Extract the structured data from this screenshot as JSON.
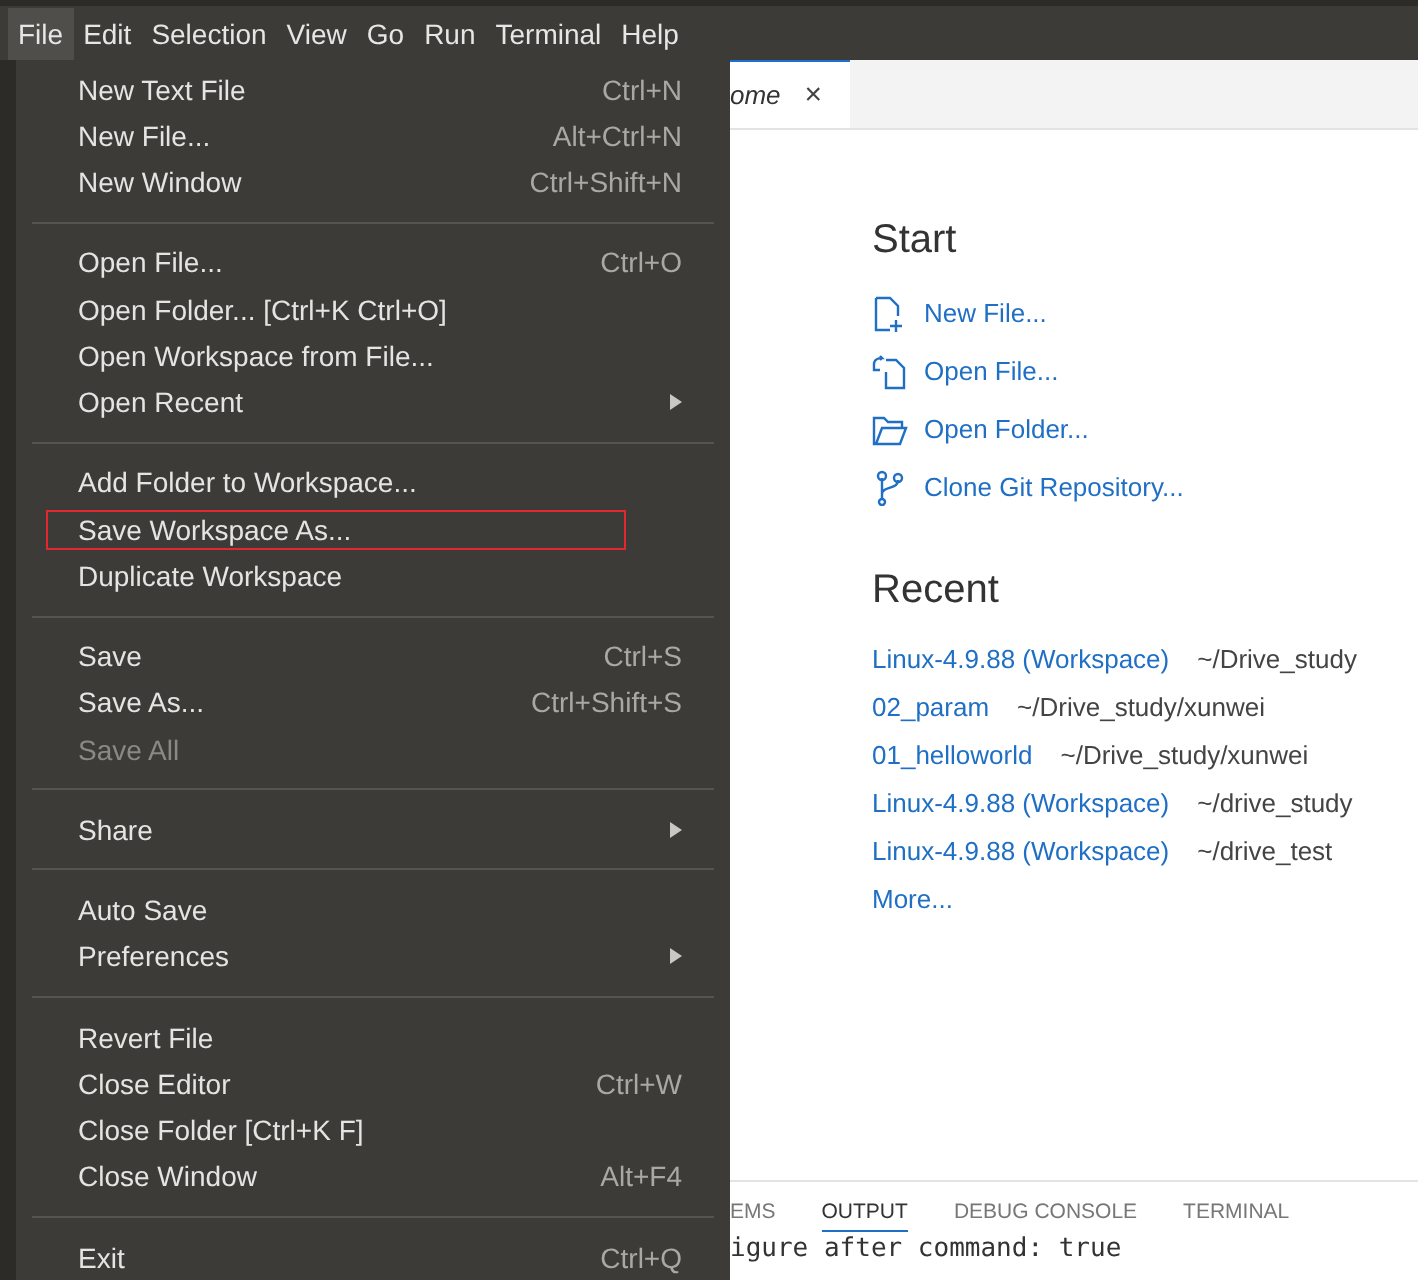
{
  "menubar": [
    {
      "label": "File",
      "selected": true
    },
    {
      "label": "Edit",
      "selected": false
    },
    {
      "label": "Selection",
      "selected": false
    },
    {
      "label": "View",
      "selected": false
    },
    {
      "label": "Go",
      "selected": false
    },
    {
      "label": "Run",
      "selected": false
    },
    {
      "label": "Terminal",
      "selected": false
    },
    {
      "label": "Help",
      "selected": false
    }
  ],
  "file_menu": [
    [
      {
        "label": "New Text File",
        "shortcut": "Ctrl+N",
        "disabled": false,
        "submenu": false,
        "annotated": false
      },
      {
        "label": "New File...",
        "shortcut": "Alt+Ctrl+N",
        "disabled": false,
        "submenu": false,
        "annotated": false
      },
      {
        "label": "New Window",
        "shortcut": "Ctrl+Shift+N",
        "disabled": false,
        "submenu": false,
        "annotated": false
      }
    ],
    [
      {
        "label": "Open File...",
        "shortcut": "Ctrl+O",
        "disabled": false,
        "submenu": false,
        "annotated": false
      },
      {
        "label": "Open Folder... [Ctrl+K Ctrl+O]",
        "disabled": false,
        "submenu": false,
        "annotated": false
      },
      {
        "label": "Open Workspace from File...",
        "disabled": false,
        "submenu": false,
        "annotated": false
      },
      {
        "label": "Open Recent",
        "disabled": false,
        "submenu": true,
        "annotated": false
      }
    ],
    [
      {
        "label": "Add Folder to Workspace...",
        "disabled": false,
        "submenu": false,
        "annotated": false
      },
      {
        "label": "Save Workspace As...",
        "disabled": false,
        "submenu": false,
        "annotated": true
      },
      {
        "label": "Duplicate Workspace",
        "disabled": false,
        "submenu": false,
        "annotated": false
      }
    ],
    [
      {
        "label": "Save",
        "shortcut": "Ctrl+S",
        "disabled": false,
        "submenu": false,
        "annotated": false
      },
      {
        "label": "Save As...",
        "shortcut": "Ctrl+Shift+S",
        "disabled": false,
        "submenu": false,
        "annotated": false
      },
      {
        "label": "Save All",
        "disabled": true,
        "submenu": false,
        "annotated": false
      }
    ],
    [
      {
        "label": "Share",
        "disabled": false,
        "submenu": true,
        "annotated": false
      }
    ],
    [
      {
        "label": "Auto Save",
        "disabled": false,
        "submenu": false,
        "annotated": false
      },
      {
        "label": "Preferences",
        "disabled": false,
        "submenu": true,
        "annotated": false
      }
    ],
    [
      {
        "label": "Revert File",
        "disabled": false,
        "submenu": false,
        "annotated": false
      },
      {
        "label": "Close Editor",
        "shortcut": "Ctrl+W",
        "disabled": false,
        "submenu": false,
        "annotated": false
      },
      {
        "label": "Close Folder [Ctrl+K F]",
        "disabled": false,
        "submenu": false,
        "annotated": false
      },
      {
        "label": "Close Window",
        "shortcut": "Alt+F4",
        "disabled": false,
        "submenu": false,
        "annotated": false
      }
    ],
    [
      {
        "label": "Exit",
        "shortcut": "Ctrl+Q",
        "disabled": false,
        "submenu": false,
        "annotated": false
      }
    ]
  ],
  "editor_tab": {
    "label": "ome",
    "close": "×"
  },
  "start": {
    "title": "Start",
    "links": [
      {
        "kind": "new-file",
        "label": "New File..."
      },
      {
        "kind": "open-file",
        "label": "Open File..."
      },
      {
        "kind": "open-folder",
        "label": "Open Folder..."
      },
      {
        "kind": "clone",
        "label": "Clone Git Repository..."
      }
    ]
  },
  "recent": {
    "title": "Recent",
    "items": [
      {
        "name": "Linux-4.9.88 (Workspace)",
        "path": "~/Drive_study"
      },
      {
        "name": "02_param",
        "path": "~/Drive_study/xunwei"
      },
      {
        "name": "01_helloworld",
        "path": "~/Drive_study/xunwei"
      },
      {
        "name": "Linux-4.9.88 (Workspace)",
        "path": "~/drive_study"
      },
      {
        "name": "Linux-4.9.88 (Workspace)",
        "path": "~/drive_test"
      }
    ],
    "more": "More..."
  },
  "panel": {
    "tabs": [
      {
        "label": "EMS",
        "selected": false
      },
      {
        "label": "OUTPUT",
        "selected": true
      },
      {
        "label": "DEBUG CONSOLE",
        "selected": false
      },
      {
        "label": "TERMINAL",
        "selected": false
      }
    ],
    "output": "igure after command: true"
  }
}
